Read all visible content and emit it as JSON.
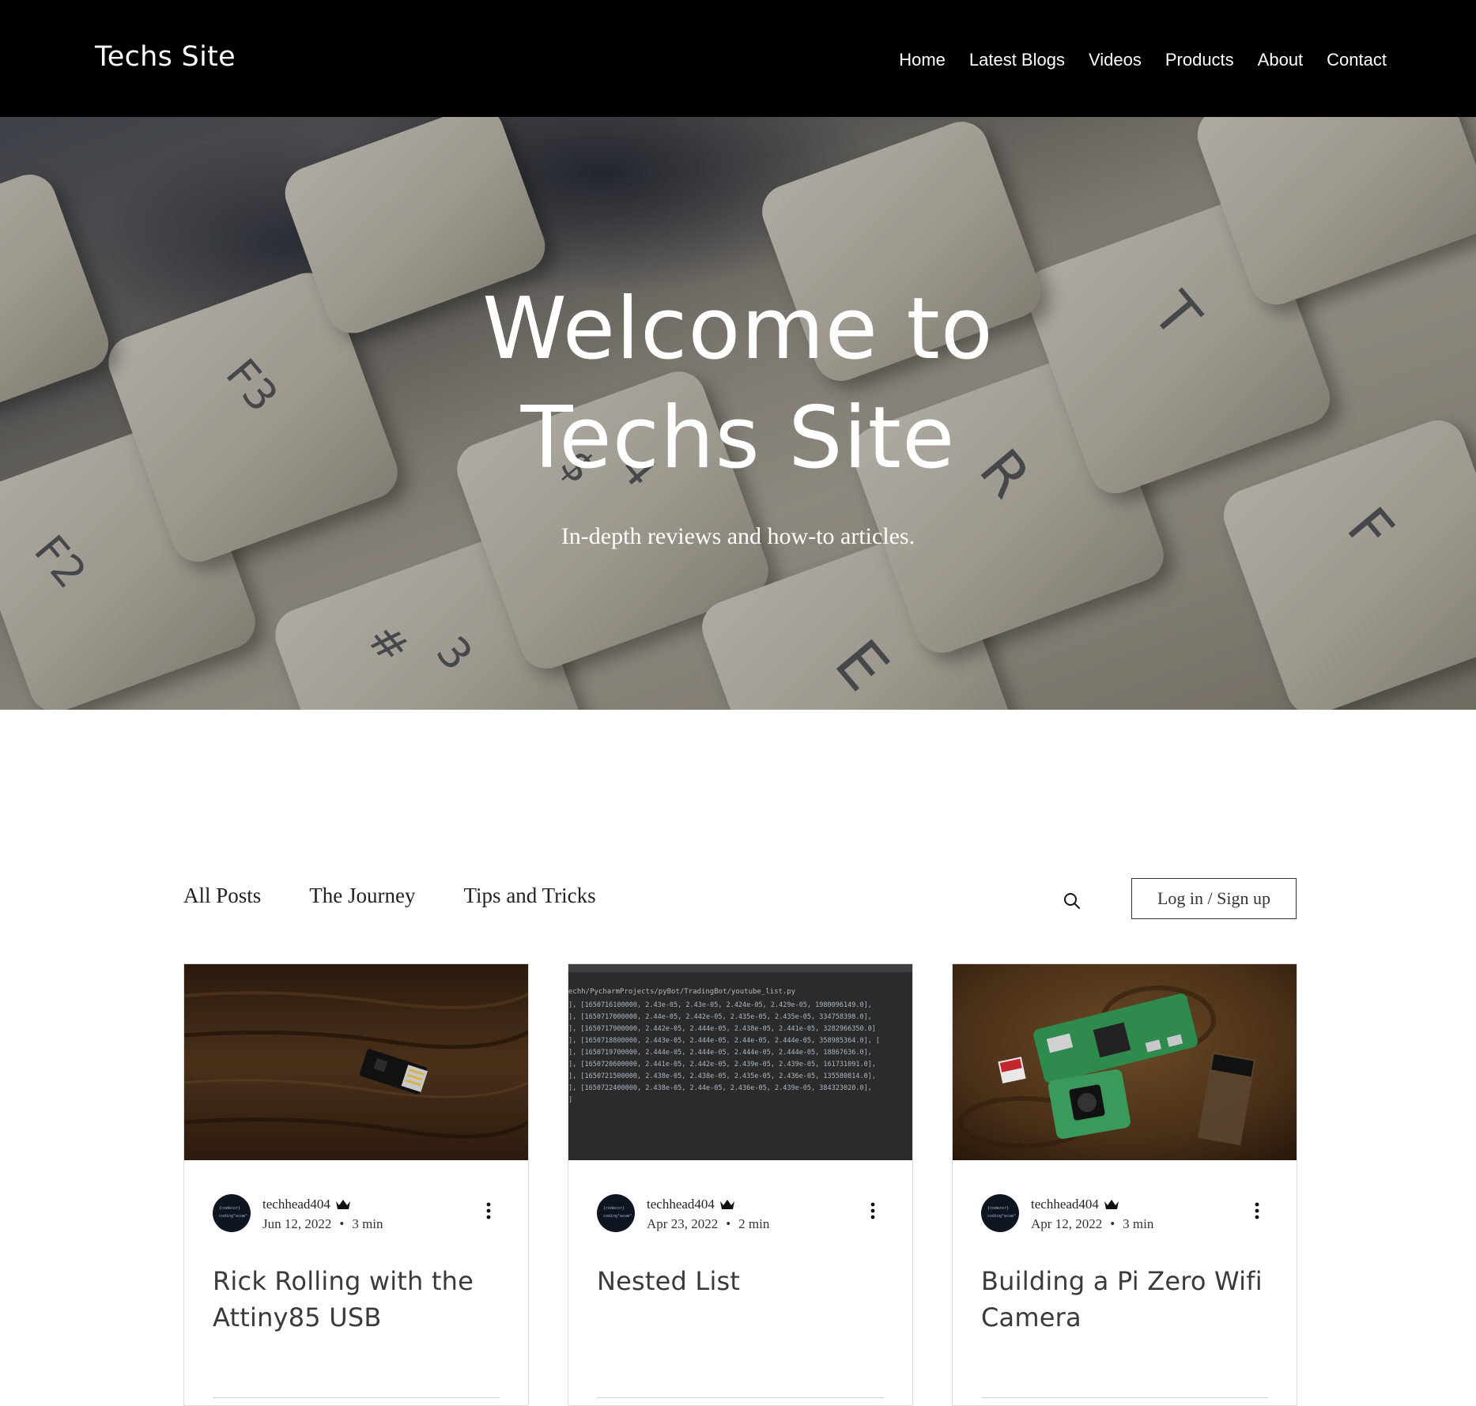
{
  "header": {
    "logo": "Techs Site",
    "nav": [
      "Home",
      "Latest Blogs",
      "Videos",
      "Products",
      "About",
      "Contact"
    ]
  },
  "hero": {
    "title_line1": "Welcome to",
    "title_line2": "Techs Site",
    "subtitle": "In-depth reviews and how-to articles.",
    "key_labels": [
      "F2",
      "F3",
      "#",
      "3",
      "E",
      "R",
      "T",
      "F",
      "$",
      "4"
    ]
  },
  "blog": {
    "categories": [
      "All Posts",
      "The Journey",
      "Tips and Tricks"
    ],
    "login_label": "Log in / Sign up",
    "posts": [
      {
        "author": "techhead404",
        "date": "Jun 12, 2022",
        "read_time": "3 min",
        "title": "Rick Rolling with the Attiny85 USB"
      },
      {
        "author": "techhead404",
        "date": "Apr 23, 2022",
        "read_time": "2 min",
        "title": "Nested List"
      },
      {
        "author": "techhead404",
        "date": "Apr 12, 2022",
        "read_time": "3 min",
        "title": "Building a Pi Zero Wifi Camera"
      }
    ],
    "code_image": {
      "path_line": "echh/PycharmProjects/pyBot/TradingBot/youtube_list.py",
      "lines": [
        "], [1650716100000, 2.43e-05, 2.43e-05, 2.424e-05, 2.429e-05, 1980096149.0],",
        "], [1650717000000, 2.44e-05, 2.442e-05, 2.435e-05, 2.435e-05, 334758398.0],",
        "], [1650717900000, 2.442e-05, 2.444e-05, 2.438e-05, 2.441e-05, 3282966350.0]",
        "], [1650718800000, 2.443e-05, 2.444e-05, 2.44e-05, 2.444e-05, 358985364.0], [",
        "], [1650719700000, 2.444e-05, 2.444e-05, 2.444e-05, 2.444e-05, 18867636.0],",
        "], [1650720600000, 2.441e-05, 2.442e-05, 2.439e-05, 2.439e-05, 161731091.0],",
        "], [1650721500000, 2.438e-05, 2.438e-05, 2.435e-05, 2.436e-05, 135580814.0],",
        "], [1650722400000, 2.438e-05, 2.44e-05, 2.436e-05, 2.439e-05, 384323020.0],",
        "]"
      ]
    },
    "avatar_text": [
      "{codecor}",
      "coding\"ecom\""
    ]
  },
  "colors": {
    "header_bg": "#000000",
    "page_bg": "#ffffff",
    "card_border": "#dcdcdc",
    "code_bg": "#2b2b2b",
    "wood": "#3a2616"
  },
  "icons": [
    "search-icon",
    "crown-icon",
    "more-vertical-icon"
  ]
}
